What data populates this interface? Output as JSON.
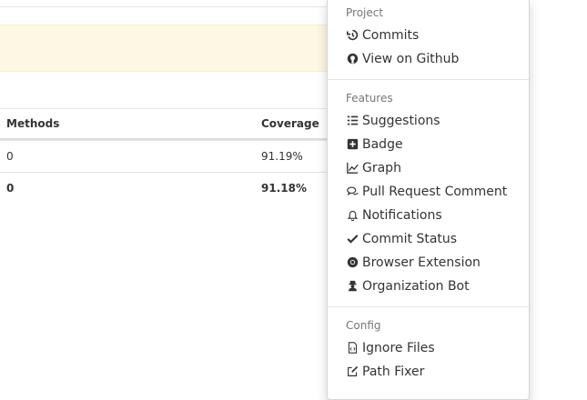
{
  "table": {
    "headers": {
      "methods": "Methods",
      "coverage": "Coverage"
    },
    "rows": [
      {
        "methods": "0",
        "coverage": "91.19%"
      },
      {
        "methods": "0",
        "coverage": "91.18%"
      }
    ]
  },
  "menu": {
    "project": {
      "header": "Project",
      "items": [
        {
          "label": "Commits",
          "icon": "history-icon"
        },
        {
          "label": "View on Github",
          "icon": "github-icon"
        }
      ]
    },
    "features": {
      "header": "Features",
      "items": [
        {
          "label": "Suggestions",
          "icon": "list-icon"
        },
        {
          "label": "Badge",
          "icon": "plus-square-icon"
        },
        {
          "label": "Graph",
          "icon": "line-chart-icon"
        },
        {
          "label": "Pull Request Comment",
          "icon": "comments-icon"
        },
        {
          "label": "Notifications",
          "icon": "bell-icon"
        },
        {
          "label": "Commit Status",
          "icon": "check-icon"
        },
        {
          "label": "Browser Extension",
          "icon": "chrome-icon"
        },
        {
          "label": "Organization Bot",
          "icon": "user-secret-icon"
        }
      ]
    },
    "config": {
      "header": "Config",
      "items": [
        {
          "label": "Ignore Files",
          "icon": "file-code-icon"
        },
        {
          "label": "Path Fixer",
          "icon": "edit-icon"
        },
        {
          "label": "",
          "icon": "unknown-icon"
        }
      ]
    }
  }
}
